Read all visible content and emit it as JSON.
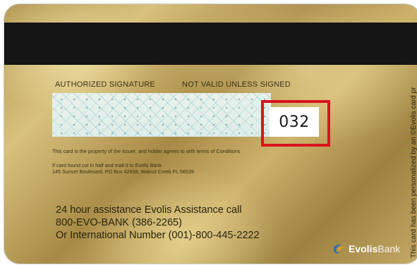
{
  "card": {
    "signature_label": "AUTHORIZED SIGNATURE",
    "not_valid_label": "NOT VALID UNLESS SIGNED",
    "cvv": "032",
    "property_notice": "This card is the property of the issuer, and holder agrees to with terms of Conditions",
    "cut_notice_line1": "If card found cut in half and mail it to Evolis Bank",
    "cut_notice_line2": "145 Sunset Boulevard, PO Box 42658, Walnut Creek FL 56539",
    "assistance_line1": "24 hour assistance Evolis Assistance call",
    "assistance_line2": "800-EVO-BANK (386-2265)",
    "assistance_line3": "Or International Number (001)-800-445-2222",
    "vertical_note": "This card has been personalized by an ©Evolis card pr",
    "logo_bold": "Evolis",
    "logo_thin": "Bank"
  },
  "colors": {
    "highlight": "#d8141c",
    "magstripe": "#141414"
  }
}
